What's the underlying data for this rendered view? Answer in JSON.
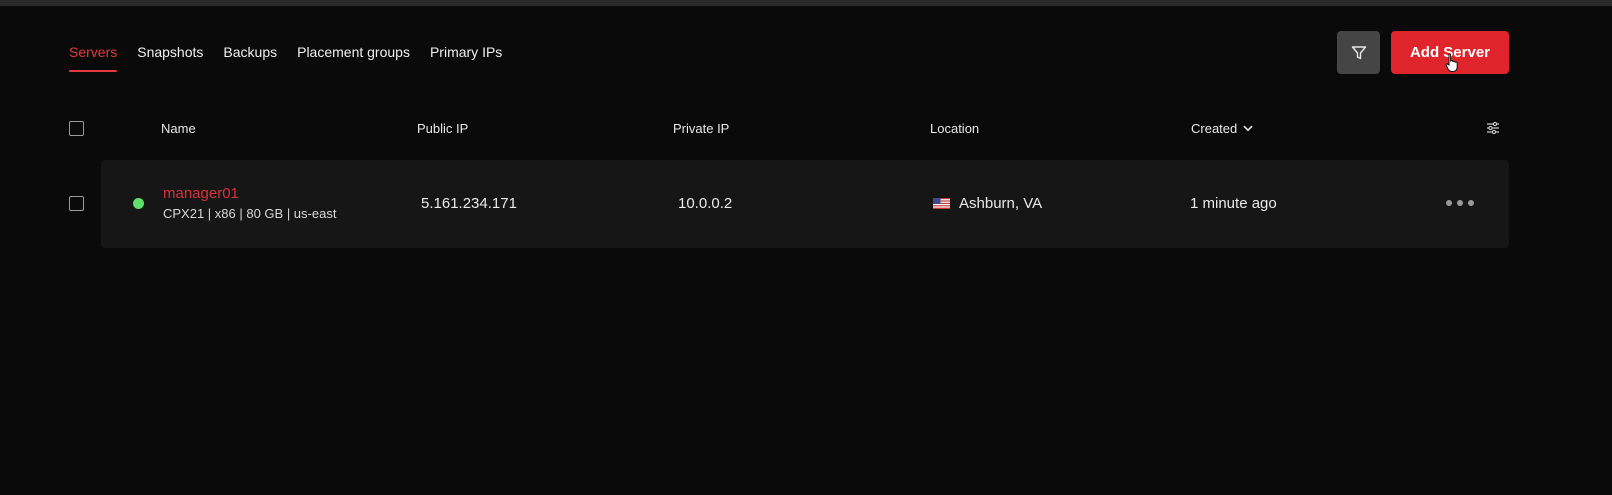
{
  "tabs": [
    {
      "label": "Servers",
      "active": true
    },
    {
      "label": "Snapshots",
      "active": false
    },
    {
      "label": "Backups",
      "active": false
    },
    {
      "label": "Placement groups",
      "active": false
    },
    {
      "label": "Primary IPs",
      "active": false
    }
  ],
  "toolbar": {
    "filter_icon": "filter-icon",
    "add_label": "Add Server"
  },
  "table": {
    "columns": {
      "name": "Name",
      "public_ip": "Public IP",
      "private_ip": "Private IP",
      "location": "Location",
      "created": "Created"
    },
    "rows": [
      {
        "status": "running",
        "name": "manager01",
        "spec": "CPX21 | x86 | 80 GB | us-east",
        "public_ip": "5.161.234.171",
        "private_ip": "10.0.0.2",
        "location": "Ashburn, VA",
        "flag": "us-flag-icon",
        "created": "1 minute ago"
      }
    ]
  },
  "colors": {
    "accent": "#e0242b",
    "active_tab": "#e5393f",
    "status_running": "#5fe06a",
    "background": "#0a0a0a",
    "row_background": "#161616"
  }
}
